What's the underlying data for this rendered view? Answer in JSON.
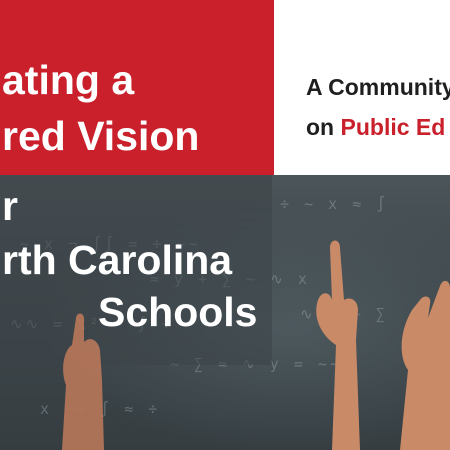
{
  "cover": {
    "title_lines": [
      "ating a",
      "red Vision",
      "r",
      "rth Carolina",
      "Schools"
    ],
    "subtitle_line1": "A Community",
    "subtitle_line2_prefix": "on ",
    "subtitle_line2_accent": "Public Ed"
  },
  "colors": {
    "red": "#c9202b",
    "white": "#ffffff",
    "chalkboard": "#3f484c",
    "skin": "#c98a68"
  }
}
